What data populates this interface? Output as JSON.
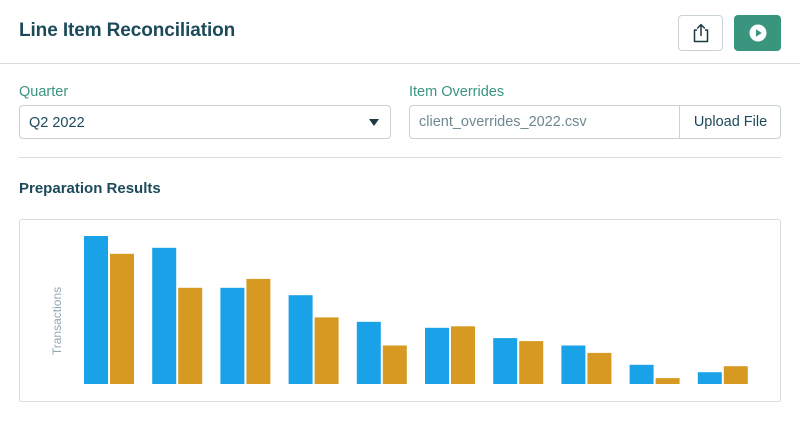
{
  "header": {
    "title": "Line Item Reconciliation",
    "share_icon": "share-icon",
    "run_icon": "play-icon",
    "accent_color": "#3a957f"
  },
  "form": {
    "quarter": {
      "label": "Quarter",
      "selected": "Q2 2022"
    },
    "overrides": {
      "label": "Item Overrides",
      "value": "client_overrides_2022.csv",
      "button_label": "Upload File"
    }
  },
  "results": {
    "title": "Preparation Results"
  },
  "chart_data": {
    "type": "bar",
    "ylabel": "Transactions",
    "xlabel": "",
    "grid": false,
    "legend": "none",
    "ylim": [
      0,
      100
    ],
    "series": [
      {
        "color": "#1aa2e8",
        "values": [
          100,
          92,
          65,
          60,
          42,
          38,
          31,
          26,
          13,
          8
        ]
      },
      {
        "color": "#d69a22",
        "values": [
          88,
          65,
          71,
          45,
          26,
          39,
          29,
          21,
          4,
          12
        ]
      }
    ]
  }
}
